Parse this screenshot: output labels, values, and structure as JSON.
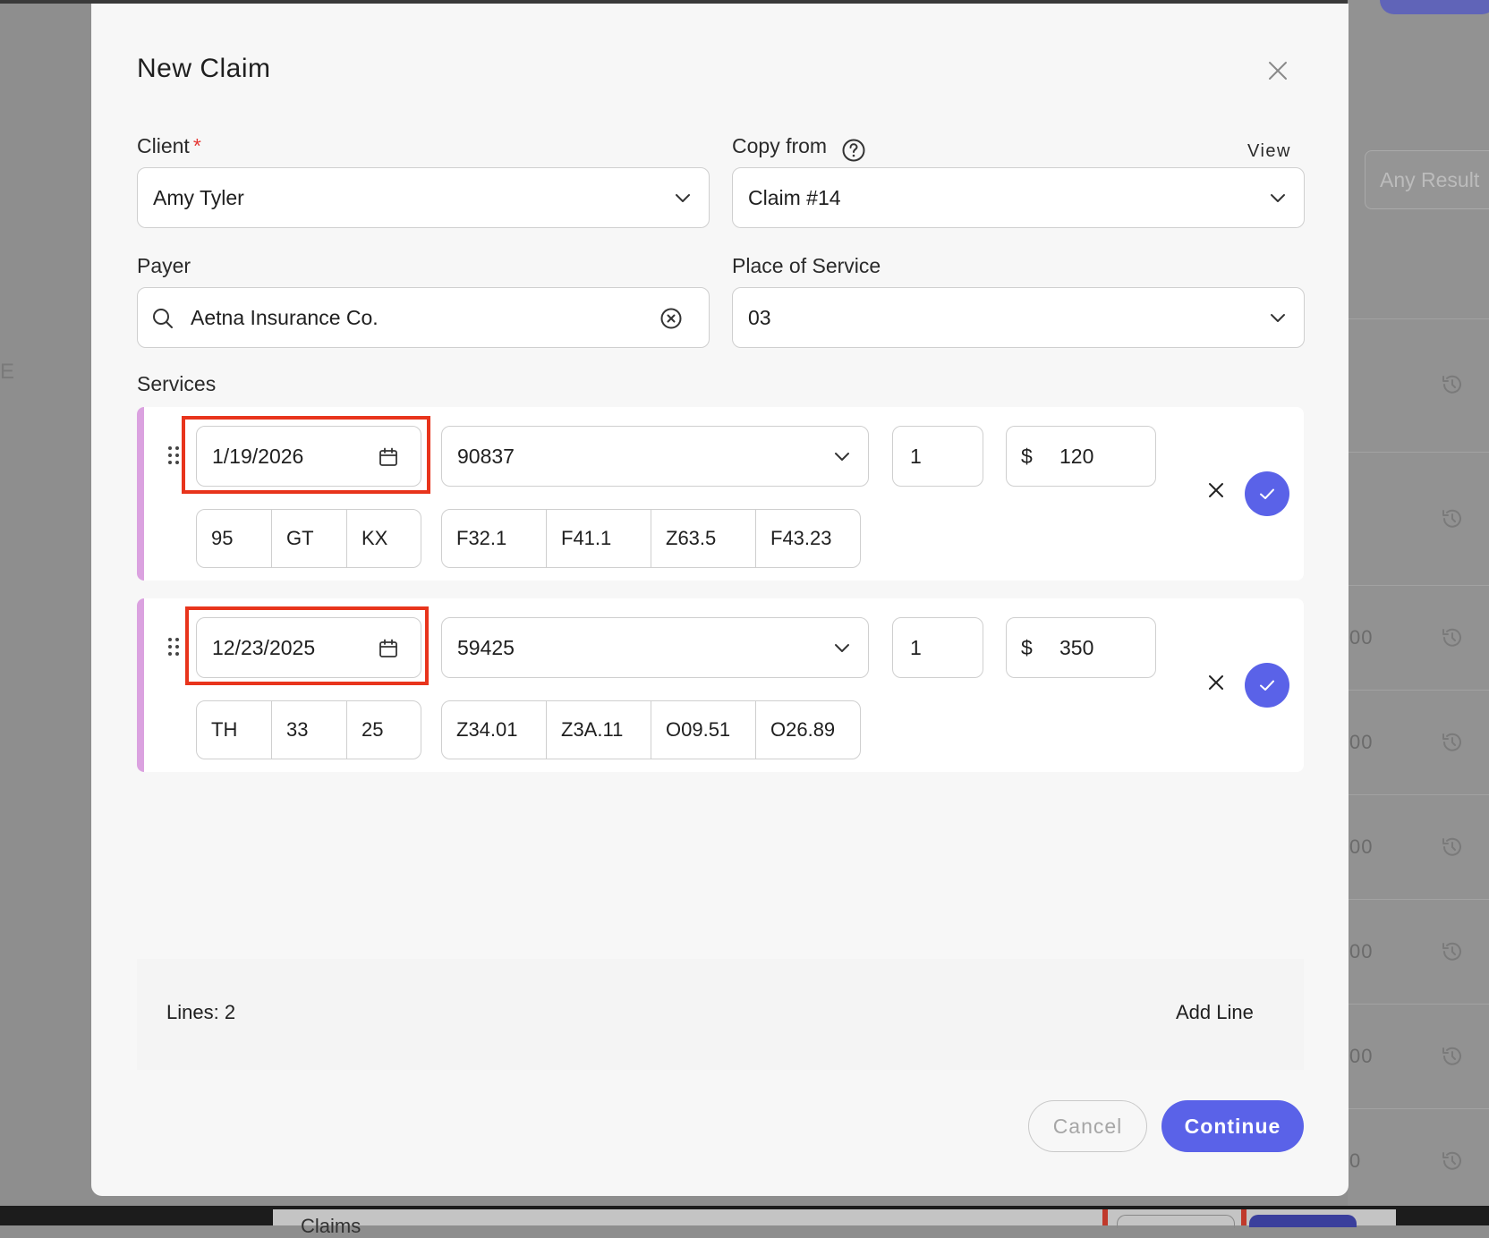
{
  "background": {
    "filter_label": "Any Result",
    "amounts": [
      "00",
      "00",
      "00",
      "00",
      "00",
      "0"
    ],
    "side_letter": "E",
    "bottom_title": "Claims"
  },
  "modal": {
    "title": "New Claim",
    "client": {
      "label": "Client",
      "required_mark": "*",
      "value": "Amy Tyler"
    },
    "copy_from": {
      "label": "Copy from",
      "value": "Claim #14",
      "view_link": "View"
    },
    "payer": {
      "label": "Payer",
      "value": "Aetna Insurance Co."
    },
    "place_of_service": {
      "label": "Place of Service",
      "value": "03"
    },
    "services_label": "Services",
    "services": [
      {
        "date": "1/19/2026",
        "code": "90837",
        "units": "1",
        "currency": "$",
        "amount": "120",
        "modifiers": [
          "95",
          "GT",
          "KX"
        ],
        "diagnoses": [
          "F32.1",
          "F41.1",
          "Z63.5",
          "F43.23"
        ]
      },
      {
        "date": "12/23/2025",
        "code": "59425",
        "units": "1",
        "currency": "$",
        "amount": "350",
        "modifiers": [
          "TH",
          "33",
          "25"
        ],
        "diagnoses": [
          "Z34.01",
          "Z3A.11",
          "O09.51",
          "O26.89"
        ]
      }
    ],
    "lines_count": "Lines: 2",
    "add_line": "Add Line",
    "cancel": "Cancel",
    "continue": "Continue"
  },
  "colors": {
    "accent": "#5a62e8",
    "highlight_box": "#e8341c",
    "service_stripe": "#dba2e0",
    "required": "#e53935"
  }
}
